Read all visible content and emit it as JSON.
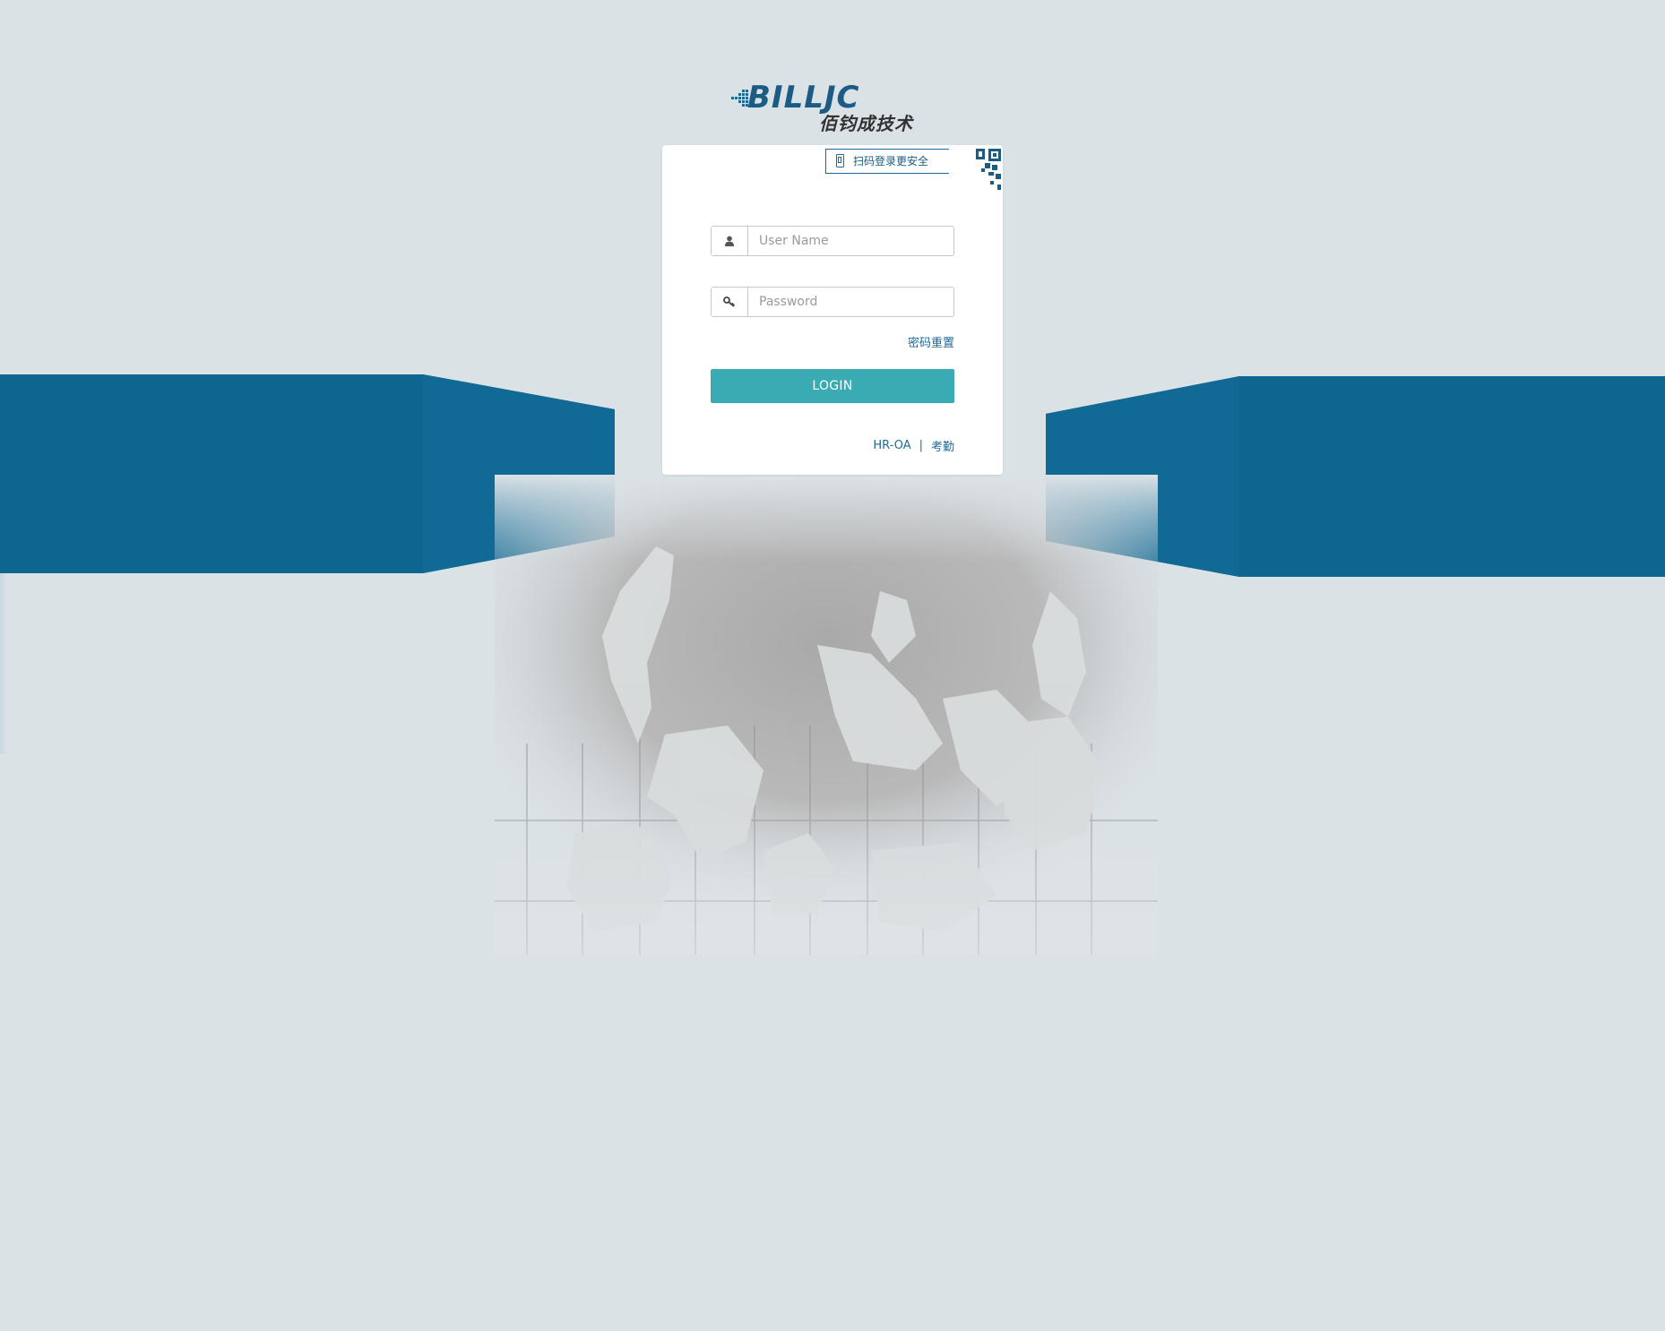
{
  "logo": {
    "wordmark": "BILLJC",
    "subtitle": "佰钧成技术"
  },
  "qr": {
    "tip_text": "扫码登录更安全"
  },
  "form": {
    "username_placeholder": "User Name",
    "password_placeholder": "Password",
    "reset_link": "密码重置",
    "login_label": "LOGIN"
  },
  "footer": {
    "link_hroa": "HR-OA",
    "separator": "|",
    "link_attendance": "考勤"
  },
  "colors": {
    "band": "#0e6590",
    "background": "#dbe2e6",
    "login_button": "#3aabb3",
    "link": "#1e6b9a"
  }
}
